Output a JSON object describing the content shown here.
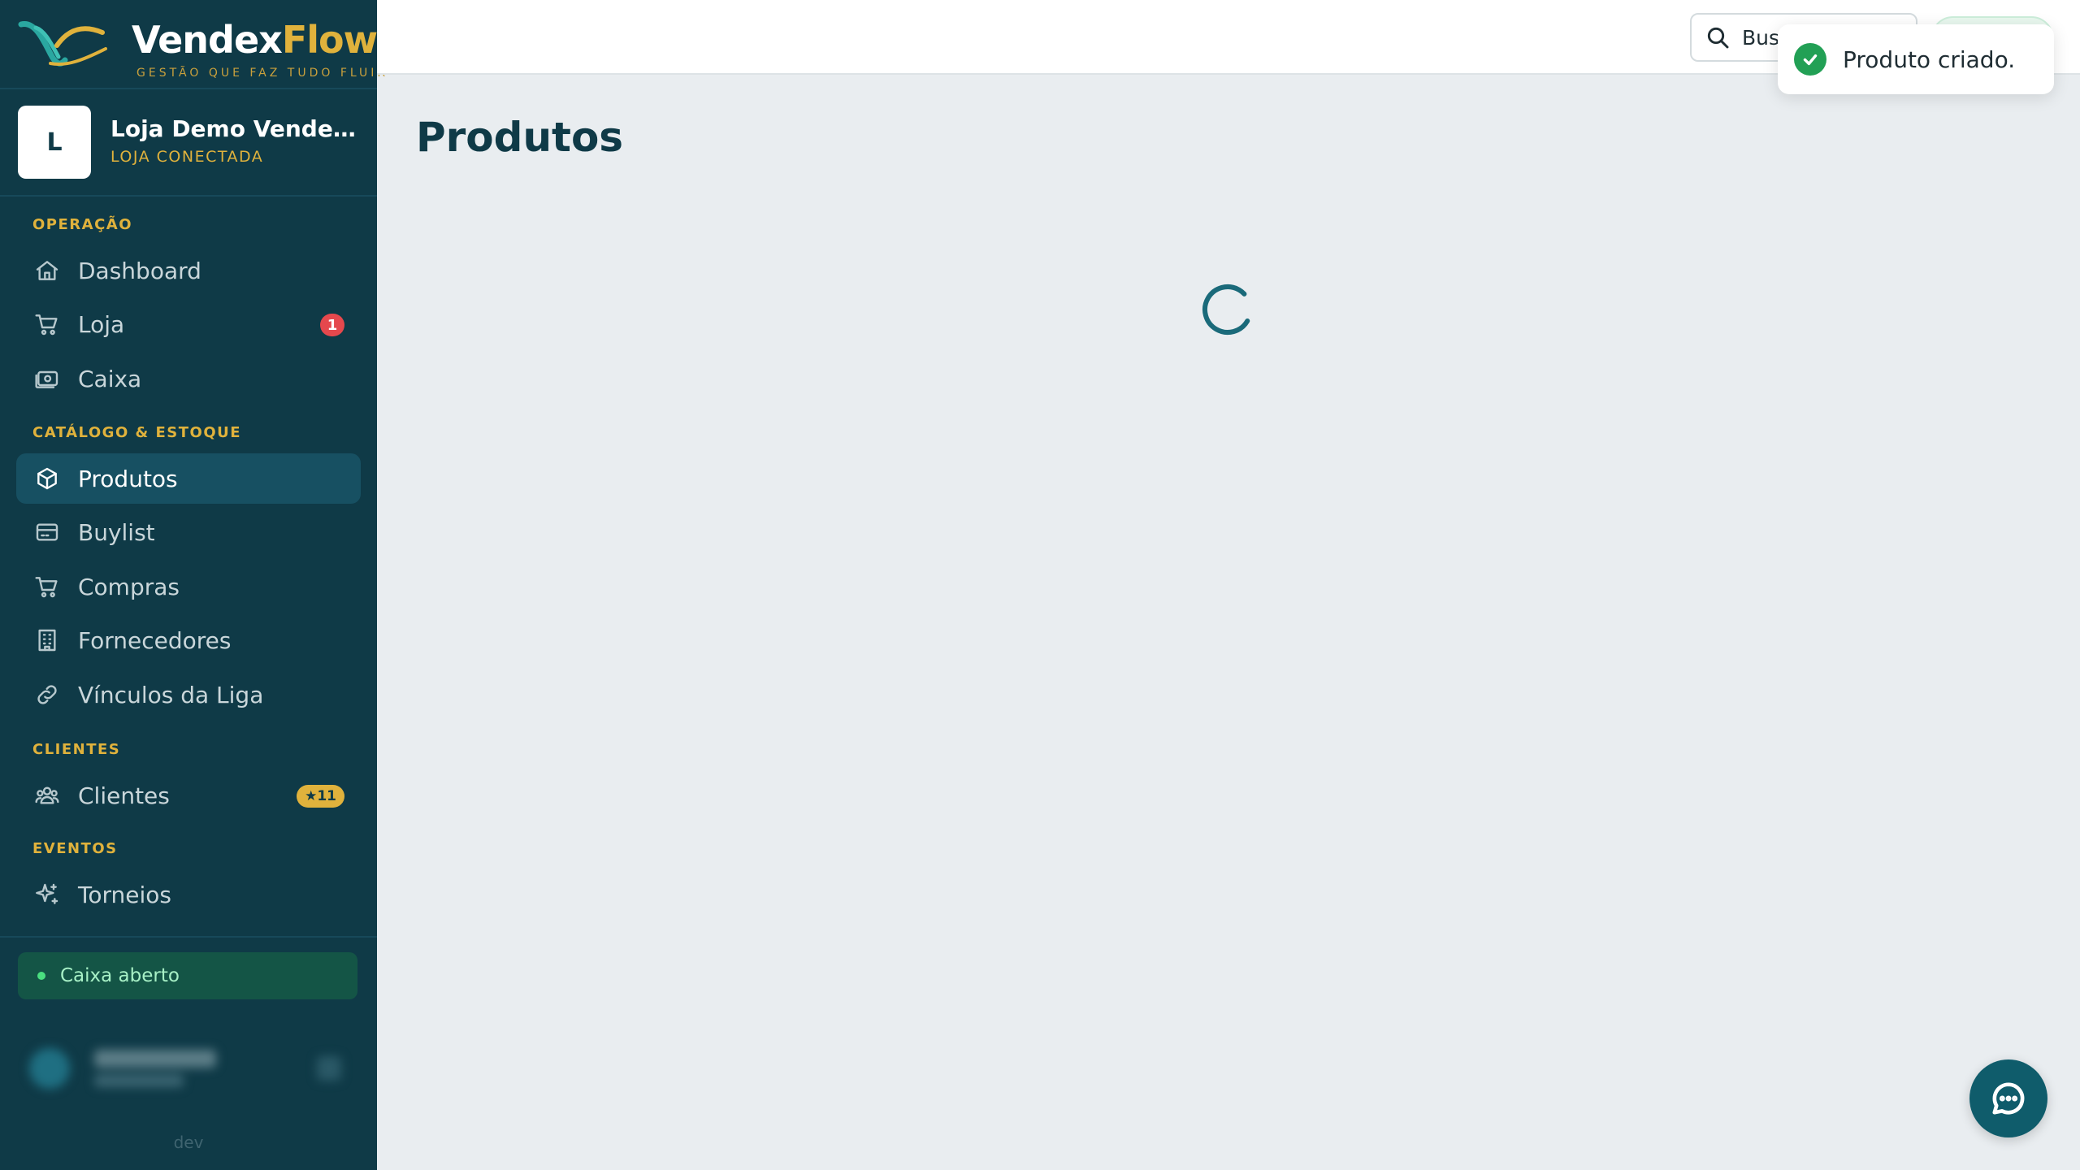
{
  "brand": {
    "name_primary": "Vendex",
    "name_accent": "Flow",
    "tagline": "GESTÃO QUE FAZ TUDO FLUIR"
  },
  "store": {
    "initial": "L",
    "name": "Loja Demo VendexFlow",
    "status": "LOJA CONECTADA"
  },
  "sidebar": {
    "sections": {
      "operacao": "OPERAÇÃO",
      "catalogo": "CATÁLOGO & ESTOQUE",
      "clientes": "CLIENTES",
      "eventos": "EVENTOS"
    },
    "items": {
      "dashboard": {
        "label": "Dashboard",
        "icon": "home-icon"
      },
      "loja": {
        "label": "Loja",
        "icon": "cart-icon",
        "badge": "1"
      },
      "caixa": {
        "label": "Caixa",
        "icon": "cash-register-icon"
      },
      "produtos": {
        "label": "Produtos",
        "icon": "box-icon",
        "active": true
      },
      "buylist": {
        "label": "Buylist",
        "icon": "card-icon"
      },
      "compras": {
        "label": "Compras",
        "icon": "cart-icon"
      },
      "fornecedores": {
        "label": "Fornecedores",
        "icon": "building-icon"
      },
      "vinculos": {
        "label": "Vínculos da Liga",
        "icon": "link-icon"
      },
      "clientes": {
        "label": "Clientes",
        "icon": "users-icon",
        "badge": "★11"
      },
      "torneios": {
        "label": "Torneios",
        "icon": "sparkles-icon"
      }
    },
    "cash_status": "Caixa aberto",
    "environment": "dev"
  },
  "topbar": {
    "search_placeholder": "Buscar..."
  },
  "toast": {
    "message": "Produto criado."
  },
  "main": {
    "title": "Produtos"
  },
  "colors": {
    "sidebar_bg": "#0f3a47",
    "accent_gold": "#e0b23c",
    "active_item": "#175062",
    "success": "#22a055",
    "badge_red": "#e5484d"
  }
}
